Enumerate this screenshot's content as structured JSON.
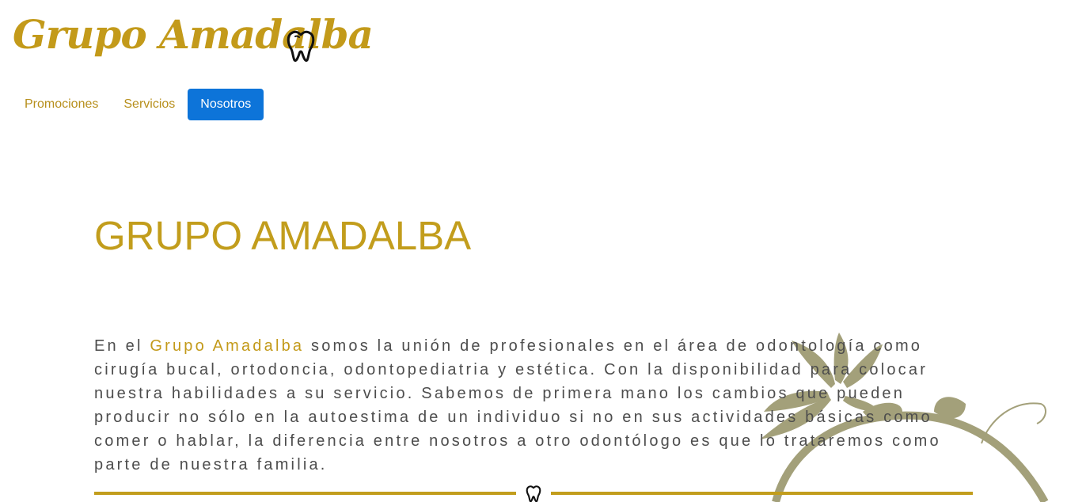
{
  "brand": {
    "name": "Grupo Amadalba",
    "icon": "tooth-icon",
    "color": "#c39a1a"
  },
  "nav": {
    "items": [
      {
        "label": "Promociones",
        "active": false
      },
      {
        "label": "Servicios",
        "active": false
      },
      {
        "label": "Nosotros",
        "active": true
      }
    ],
    "active_color": "#0d74d9"
  },
  "main": {
    "title": "GRUPO AMADALBA",
    "intro_prefix": "En el ",
    "intro_highlight": "Grupo Amadalba",
    "intro_rest": " somos la unión de profesionales en el área de odontología como cirugía bucal, ortodoncia, odontopediatria y estética. Con la disponibilidad para colocar nuestra habilidades a su servicio. Sabemos de primera mano los cambios que pueden producir no sólo en la autoestima de un individuo si no en sus actividades básicas como comer o hablar, la diferencia entre nosotros a otro odontólogo es que lo trataremos como parte de nuestra familia."
  },
  "decor": {
    "divider_icon": "tooth-icon",
    "flower_icon": "flower-vine-icon",
    "flower_color": "#a3a07a"
  }
}
